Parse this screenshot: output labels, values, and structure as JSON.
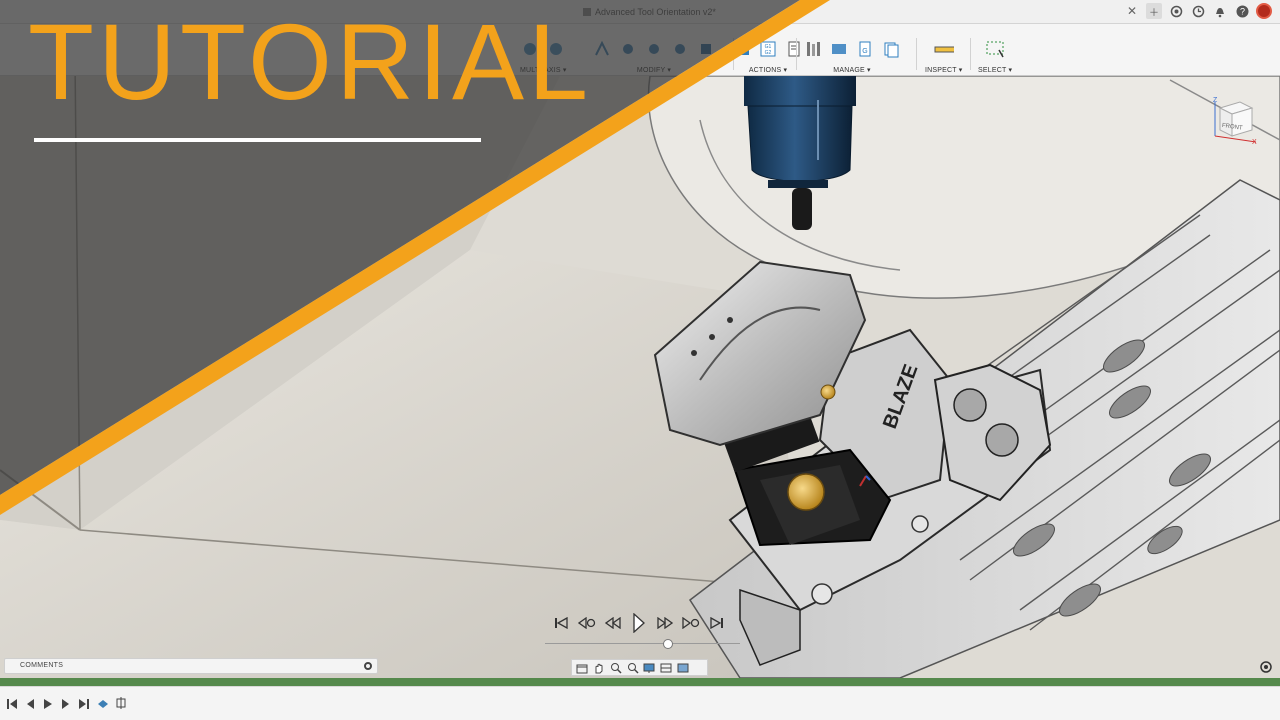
{
  "window": {
    "doc_title": "Advanced Tool Orientation v2*"
  },
  "toolbar": {
    "groups": [
      {
        "id": "multiaxis",
        "label": "MULTI-AXIS ▾"
      },
      {
        "id": "modify",
        "label": "MODIFY ▾"
      },
      {
        "id": "actions",
        "label": "ACTIONS ▾"
      },
      {
        "id": "manage",
        "label": "MANAGE ▾"
      },
      {
        "id": "inspect",
        "label": "INSPECT ▾"
      },
      {
        "id": "select",
        "label": "SELECT ▾"
      }
    ],
    "actions_g2_label": "G1 G2"
  },
  "overlay": {
    "title": "TUTORIAL",
    "accent_color": "#f3a21b"
  },
  "navcube": {
    "face_label": "FRONT",
    "axis_z": "Z",
    "axis_x": "X"
  },
  "comments": {
    "label": "COMMENTS"
  },
  "icons": {
    "playback": [
      "skip-start-icon",
      "step-back-icon",
      "rewind-icon",
      "play-icon",
      "fast-forward-icon",
      "step-forward-icon",
      "skip-end-icon"
    ],
    "viewbar": [
      "orbit-icon",
      "pan-icon",
      "look-at-icon",
      "zoom-icon",
      "display-settings-icon",
      "grid-icon",
      "viewports-icon"
    ]
  }
}
